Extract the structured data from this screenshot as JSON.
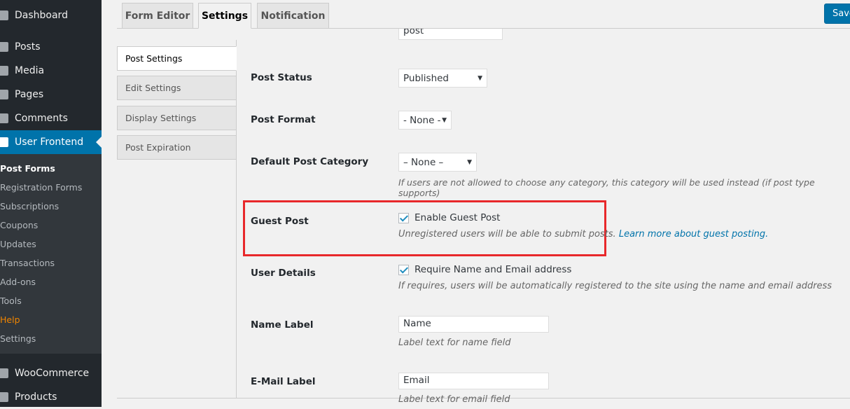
{
  "sidebar": {
    "items": [
      {
        "label": "Dashboard",
        "icon": "dashboard-icon"
      },
      {
        "label": "Posts",
        "icon": "pin-icon"
      },
      {
        "label": "Media",
        "icon": "media-icon"
      },
      {
        "label": "Pages",
        "icon": "pages-icon"
      },
      {
        "label": "Comments",
        "icon": "comments-icon"
      },
      {
        "label": "User Frontend",
        "icon": "user-frontend-icon"
      },
      {
        "label": "WooCommerce",
        "icon": "woocommerce-icon"
      },
      {
        "label": "Products",
        "icon": "products-icon"
      }
    ],
    "submenu": [
      "Post Forms",
      "Registration Forms",
      "Subscriptions",
      "Coupons",
      "Updates",
      "Transactions",
      "Add-ons",
      "Tools",
      "Help",
      "Settings"
    ]
  },
  "tabs": [
    "Form Editor",
    "Settings",
    "Notification"
  ],
  "save_label": "Save",
  "vertical_tabs": [
    "Post Settings",
    "Edit Settings",
    "Display Settings",
    "Post Expiration"
  ],
  "fields": {
    "post_type_value": "post",
    "post_status": {
      "label": "Post Status",
      "value": "Published"
    },
    "post_format": {
      "label": "Post Format",
      "value": "- None -"
    },
    "default_category": {
      "label": "Default Post Category",
      "value": "– None –",
      "desc": "If users are not allowed to choose any category, this category will be used instead (if post type supports)"
    },
    "guest_post": {
      "label": "Guest Post",
      "checkbox": "Enable Guest Post",
      "checked": true,
      "desc": "Unregistered users will be able to submit posts.",
      "link": "Learn more about guest posting."
    },
    "user_details": {
      "label": "User Details",
      "checkbox": "Require Name and Email address",
      "checked": true,
      "desc": "If requires, users will be automatically registered to the site using the name and email address"
    },
    "name_label": {
      "label": "Name Label",
      "value": "Name",
      "desc": "Label text for name field"
    },
    "email_label": {
      "label": "E-Mail Label",
      "value": "Email",
      "desc": "Label text for email field"
    }
  },
  "colors": {
    "highlight": "#e8282b",
    "accent": "#0073aa"
  }
}
